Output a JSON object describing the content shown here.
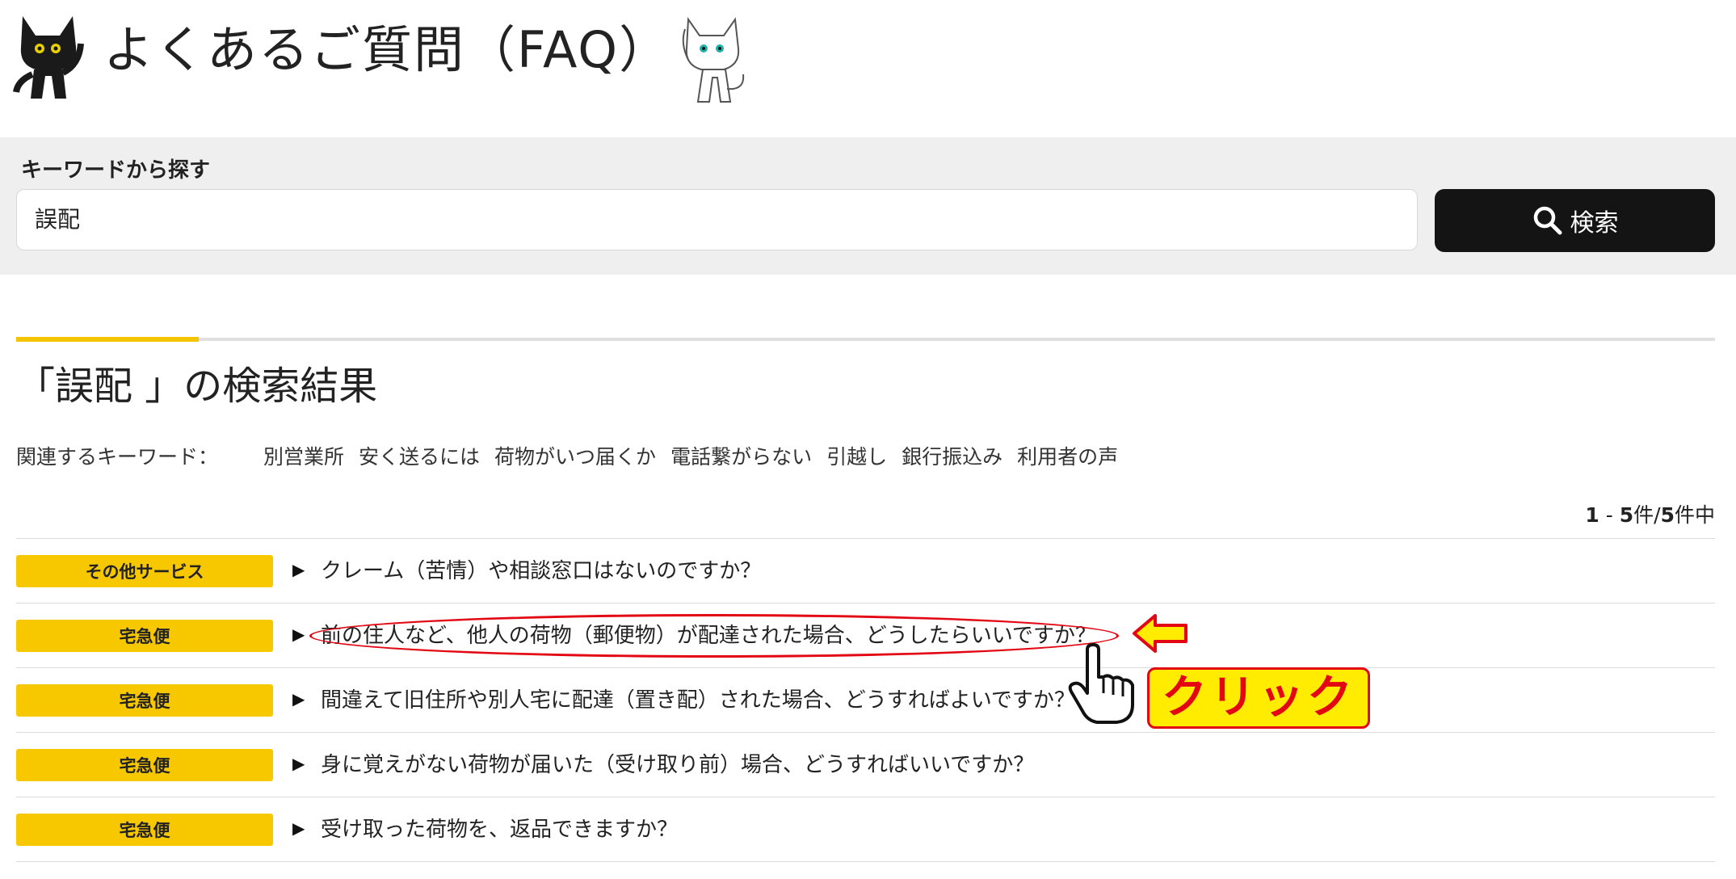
{
  "header": {
    "title": "よくあるご質問（FAQ）",
    "mascot_left": "black-cat-mascot",
    "mascot_right": "white-cat-mascot"
  },
  "search": {
    "label": "キーワードから探す",
    "value": "誤配",
    "button_label": "検索",
    "button_icon": "search-icon"
  },
  "results": {
    "title": "「誤配 」の検索結果",
    "related_label": "関連するキーワード：",
    "related_keywords": [
      "別営業所",
      "安く送るには",
      "荷物がいつ届くか",
      "電話繋がらない",
      "引越し",
      "銀行振込み",
      "利用者の声"
    ],
    "count_range_start": "1",
    "count_sep": " - ",
    "count_range_end": "5",
    "count_unit": "件/",
    "count_total": "5",
    "count_suffix": "件中",
    "items": [
      {
        "category": "その他サービス",
        "question": "クレーム（苦情）や相談窓口はないのですか？"
      },
      {
        "category": "宅急便",
        "question": "前の住人など、他人の荷物（郵便物）が配達された場合、どうしたらいいですか？"
      },
      {
        "category": "宅急便",
        "question": "間違えて旧住所や別人宅に配達（置き配）された場合、どうすればよいですか？"
      },
      {
        "category": "宅急便",
        "question": "身に覚えがない荷物が届いた（受け取り前）場合、どうすればいいですか？"
      },
      {
        "category": "宅急便",
        "question": "受け取った荷物を、返品できますか？"
      }
    ]
  },
  "annotation": {
    "click_label": "クリック",
    "colors": {
      "accent_red": "#e30613",
      "highlight_yellow": "#ffec00"
    }
  },
  "colors": {
    "badge_yellow": "#f7c800",
    "search_button": "#141414",
    "search_band": "#efefef"
  }
}
